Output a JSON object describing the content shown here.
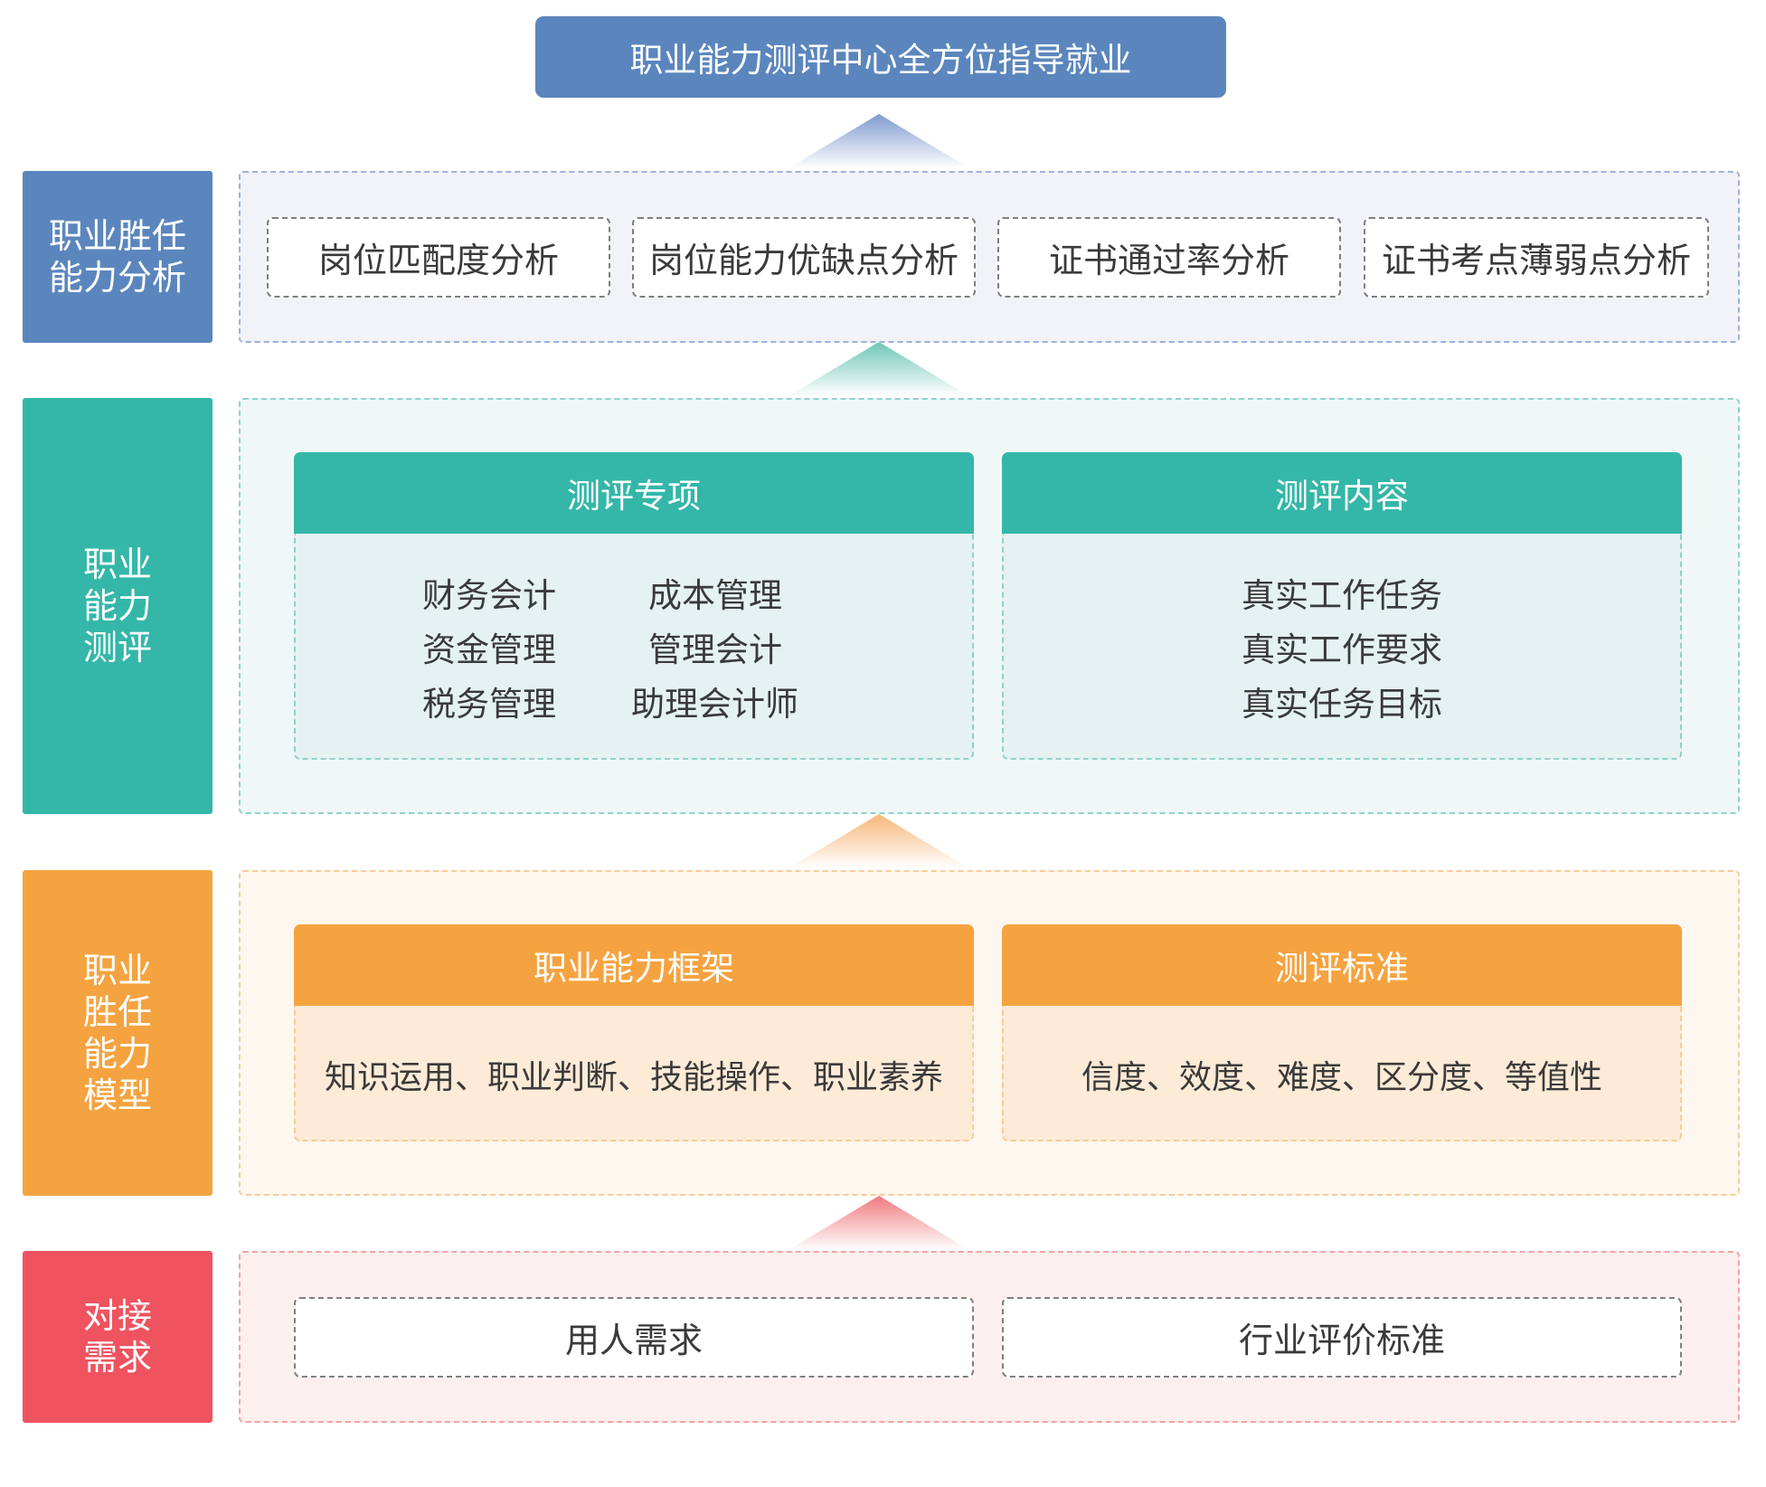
{
  "colors": {
    "blue": "#5b86bd",
    "teal": "#34b7a8",
    "orange": "#f5a340",
    "red": "#ef5360"
  },
  "top_title": "职业能力测评中心全方位指导就业",
  "tiers": {
    "analysis": {
      "label": "职业胜任能力分析",
      "boxes": [
        "岗位匹配度分析",
        "岗位能力优缺点分析",
        "证书通过率分析",
        "证书考点薄弱点分析"
      ]
    },
    "assessment": {
      "label": "职业能力测评",
      "cards": [
        {
          "title": "测评专项",
          "items": [
            "财务会计",
            "成本管理",
            "资金管理",
            "管理会计",
            "税务管理",
            "助理会计师"
          ]
        },
        {
          "title": "测评内容",
          "items": [
            "真实工作任务",
            "真实工作要求",
            "真实任务目标"
          ]
        }
      ]
    },
    "model": {
      "label": "职业胜任能力模型",
      "cards": [
        {
          "title": "职业能力框架",
          "text": "知识运用、职业判断、技能操作、职业素养"
        },
        {
          "title": "测评标准",
          "text": "信度、效度、难度、区分度、等值性"
        }
      ]
    },
    "demand": {
      "label": "对接需求",
      "boxes": [
        "用人需求",
        "行业评价标准"
      ]
    }
  }
}
